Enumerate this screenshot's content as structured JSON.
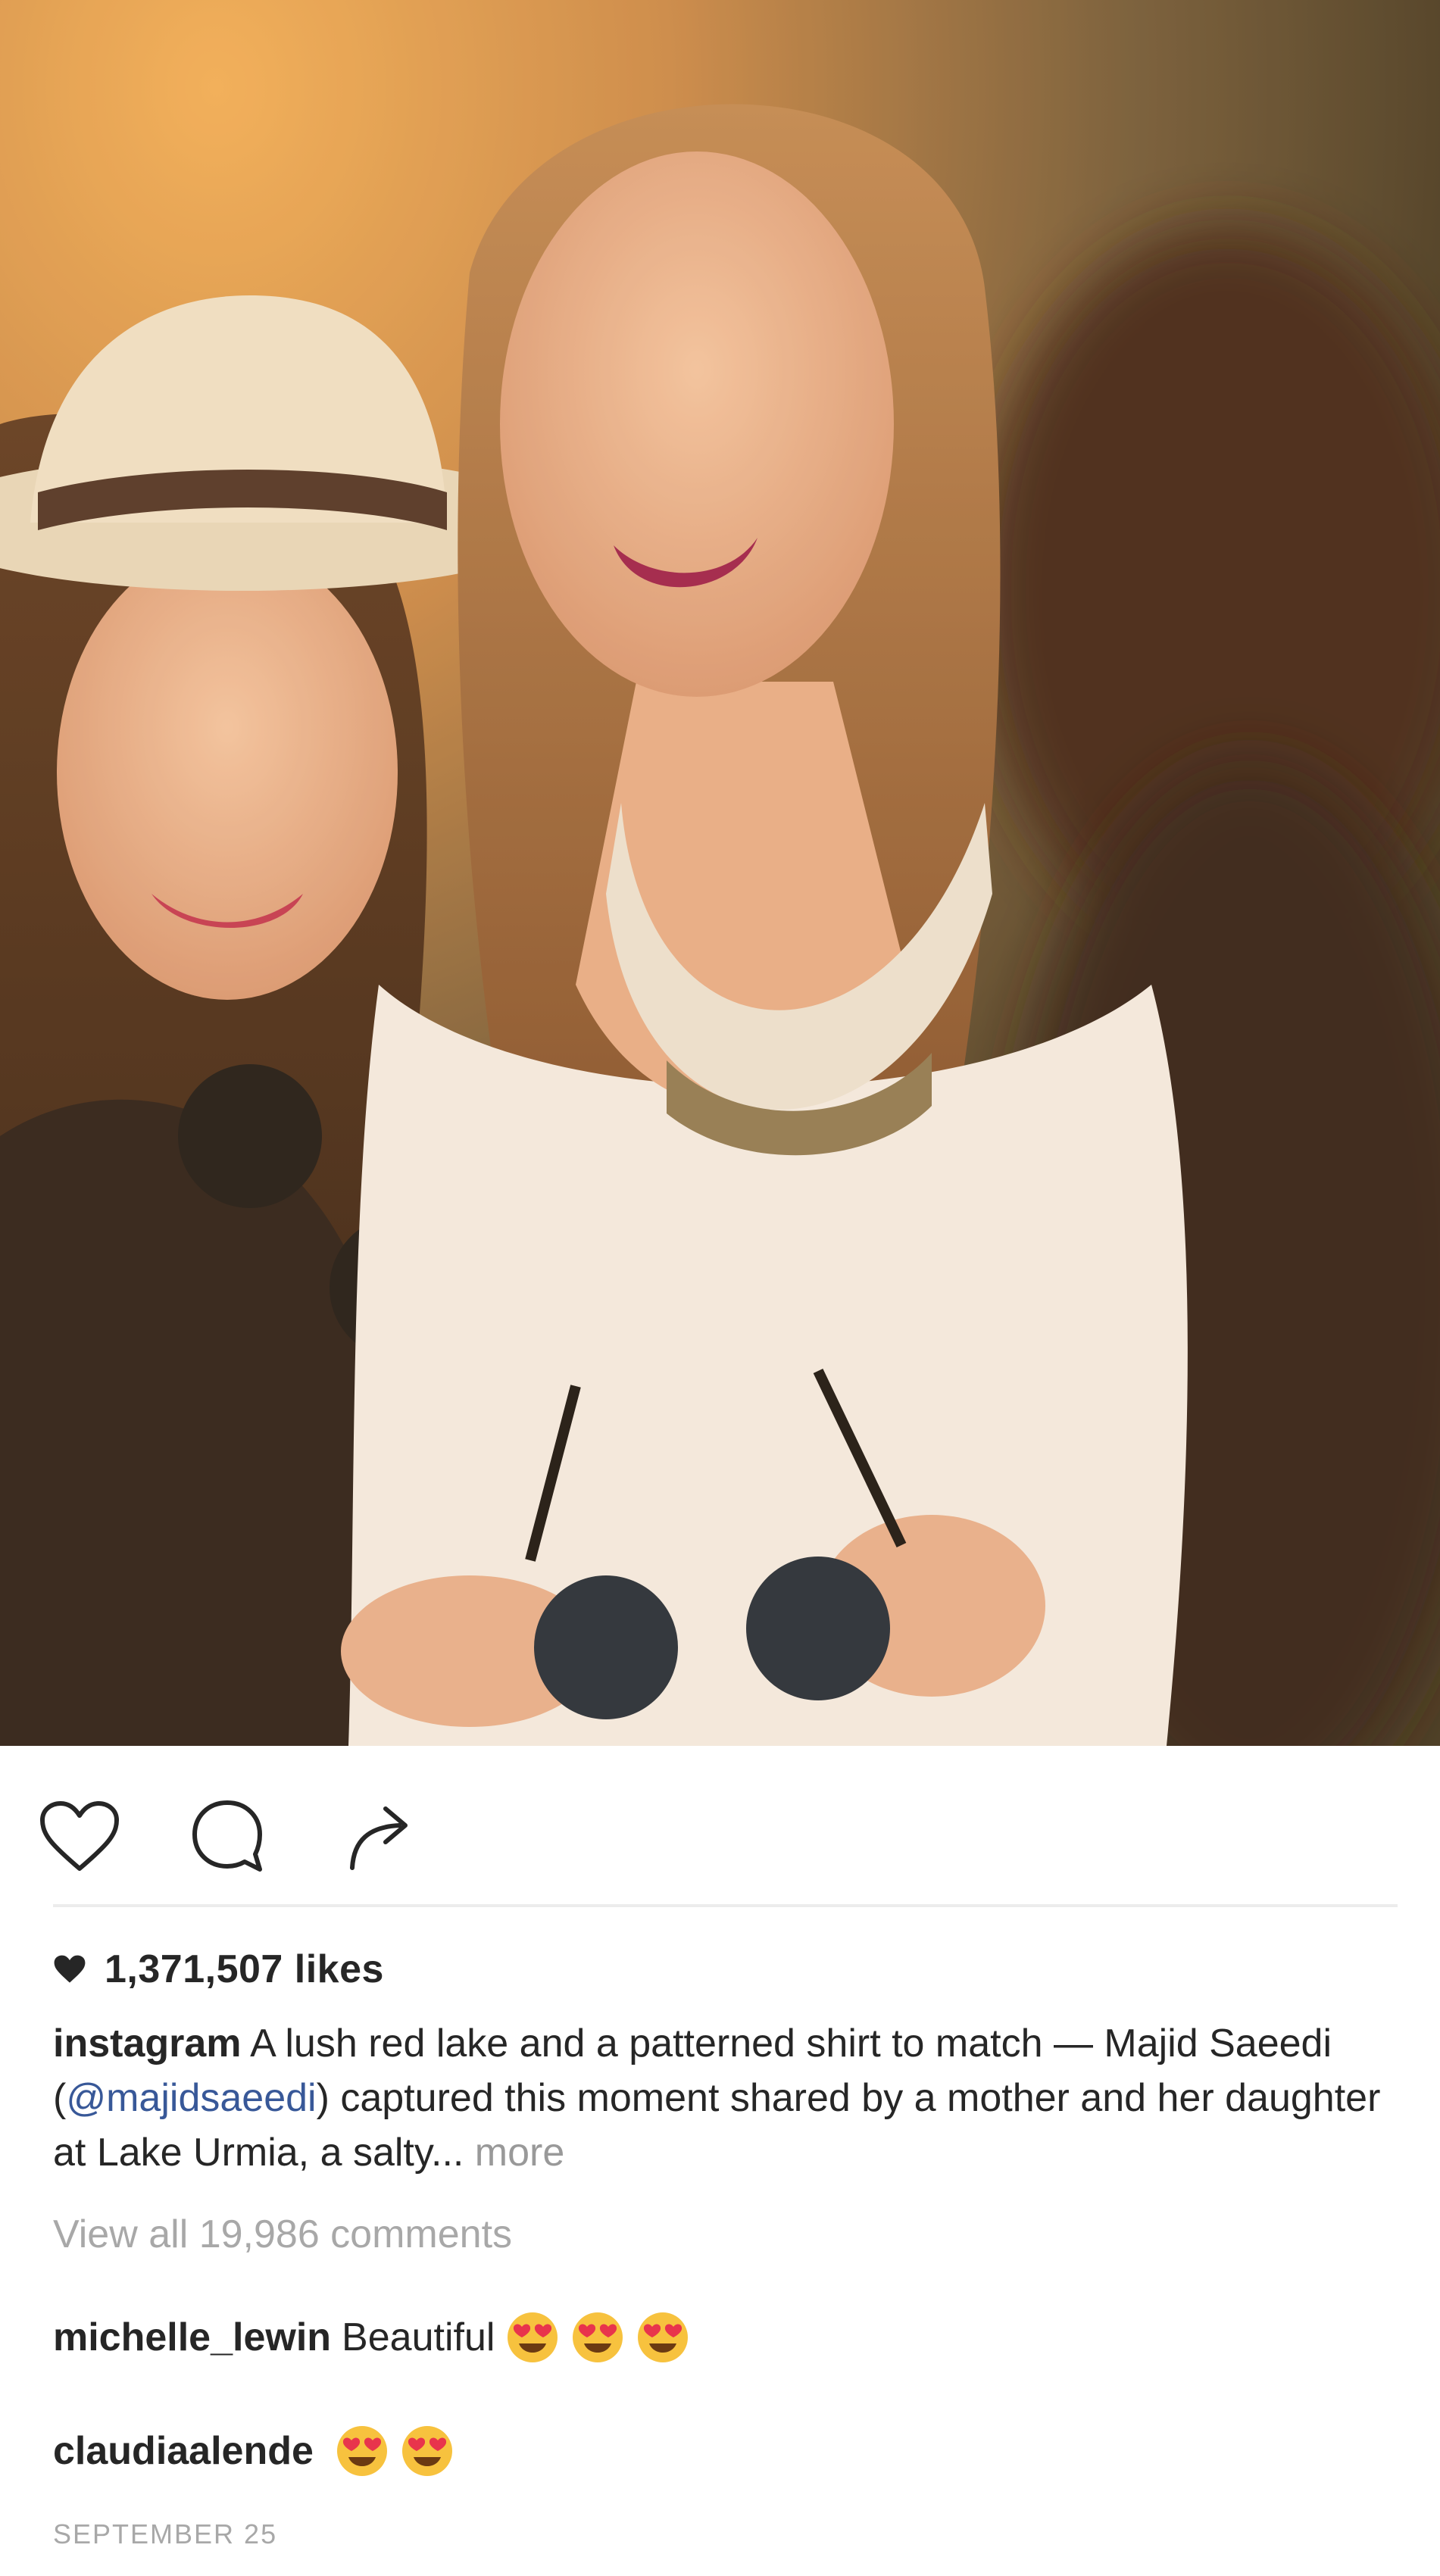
{
  "post": {
    "author": "instagram",
    "likes": "1,371,507 likes",
    "caption_parts": {
      "before_mention": "A lush red lake and a patterned shirt to match — Majid Saeedi (",
      "mention": "@majidsaeedi",
      "after_mention": ") captured this moment shared by a mother and her daughter at Lake Urmia, a salty...",
      "more": "more"
    },
    "view_comments": "View all 19,986 comments",
    "comments": [
      {
        "user": "michelle_lewin",
        "text": "Beautiful",
        "emoji_count": 3
      },
      {
        "user": "claudiaalende",
        "text": "",
        "emoji_count": 2
      }
    ],
    "date": "SEPTEMBER 25"
  },
  "icons": {
    "like": "heart-outline-icon",
    "comment": "speech-bubble-icon",
    "share": "share-arrow-icon",
    "likes_heart": "filled-heart-icon",
    "emoji": "heart-eyes-emoji"
  },
  "colors": {
    "text": "#262626",
    "mention": "#385898",
    "muted": "#a8a8a8",
    "emoji_face": "#f7c23e",
    "emoji_heart": "#e8344c"
  }
}
